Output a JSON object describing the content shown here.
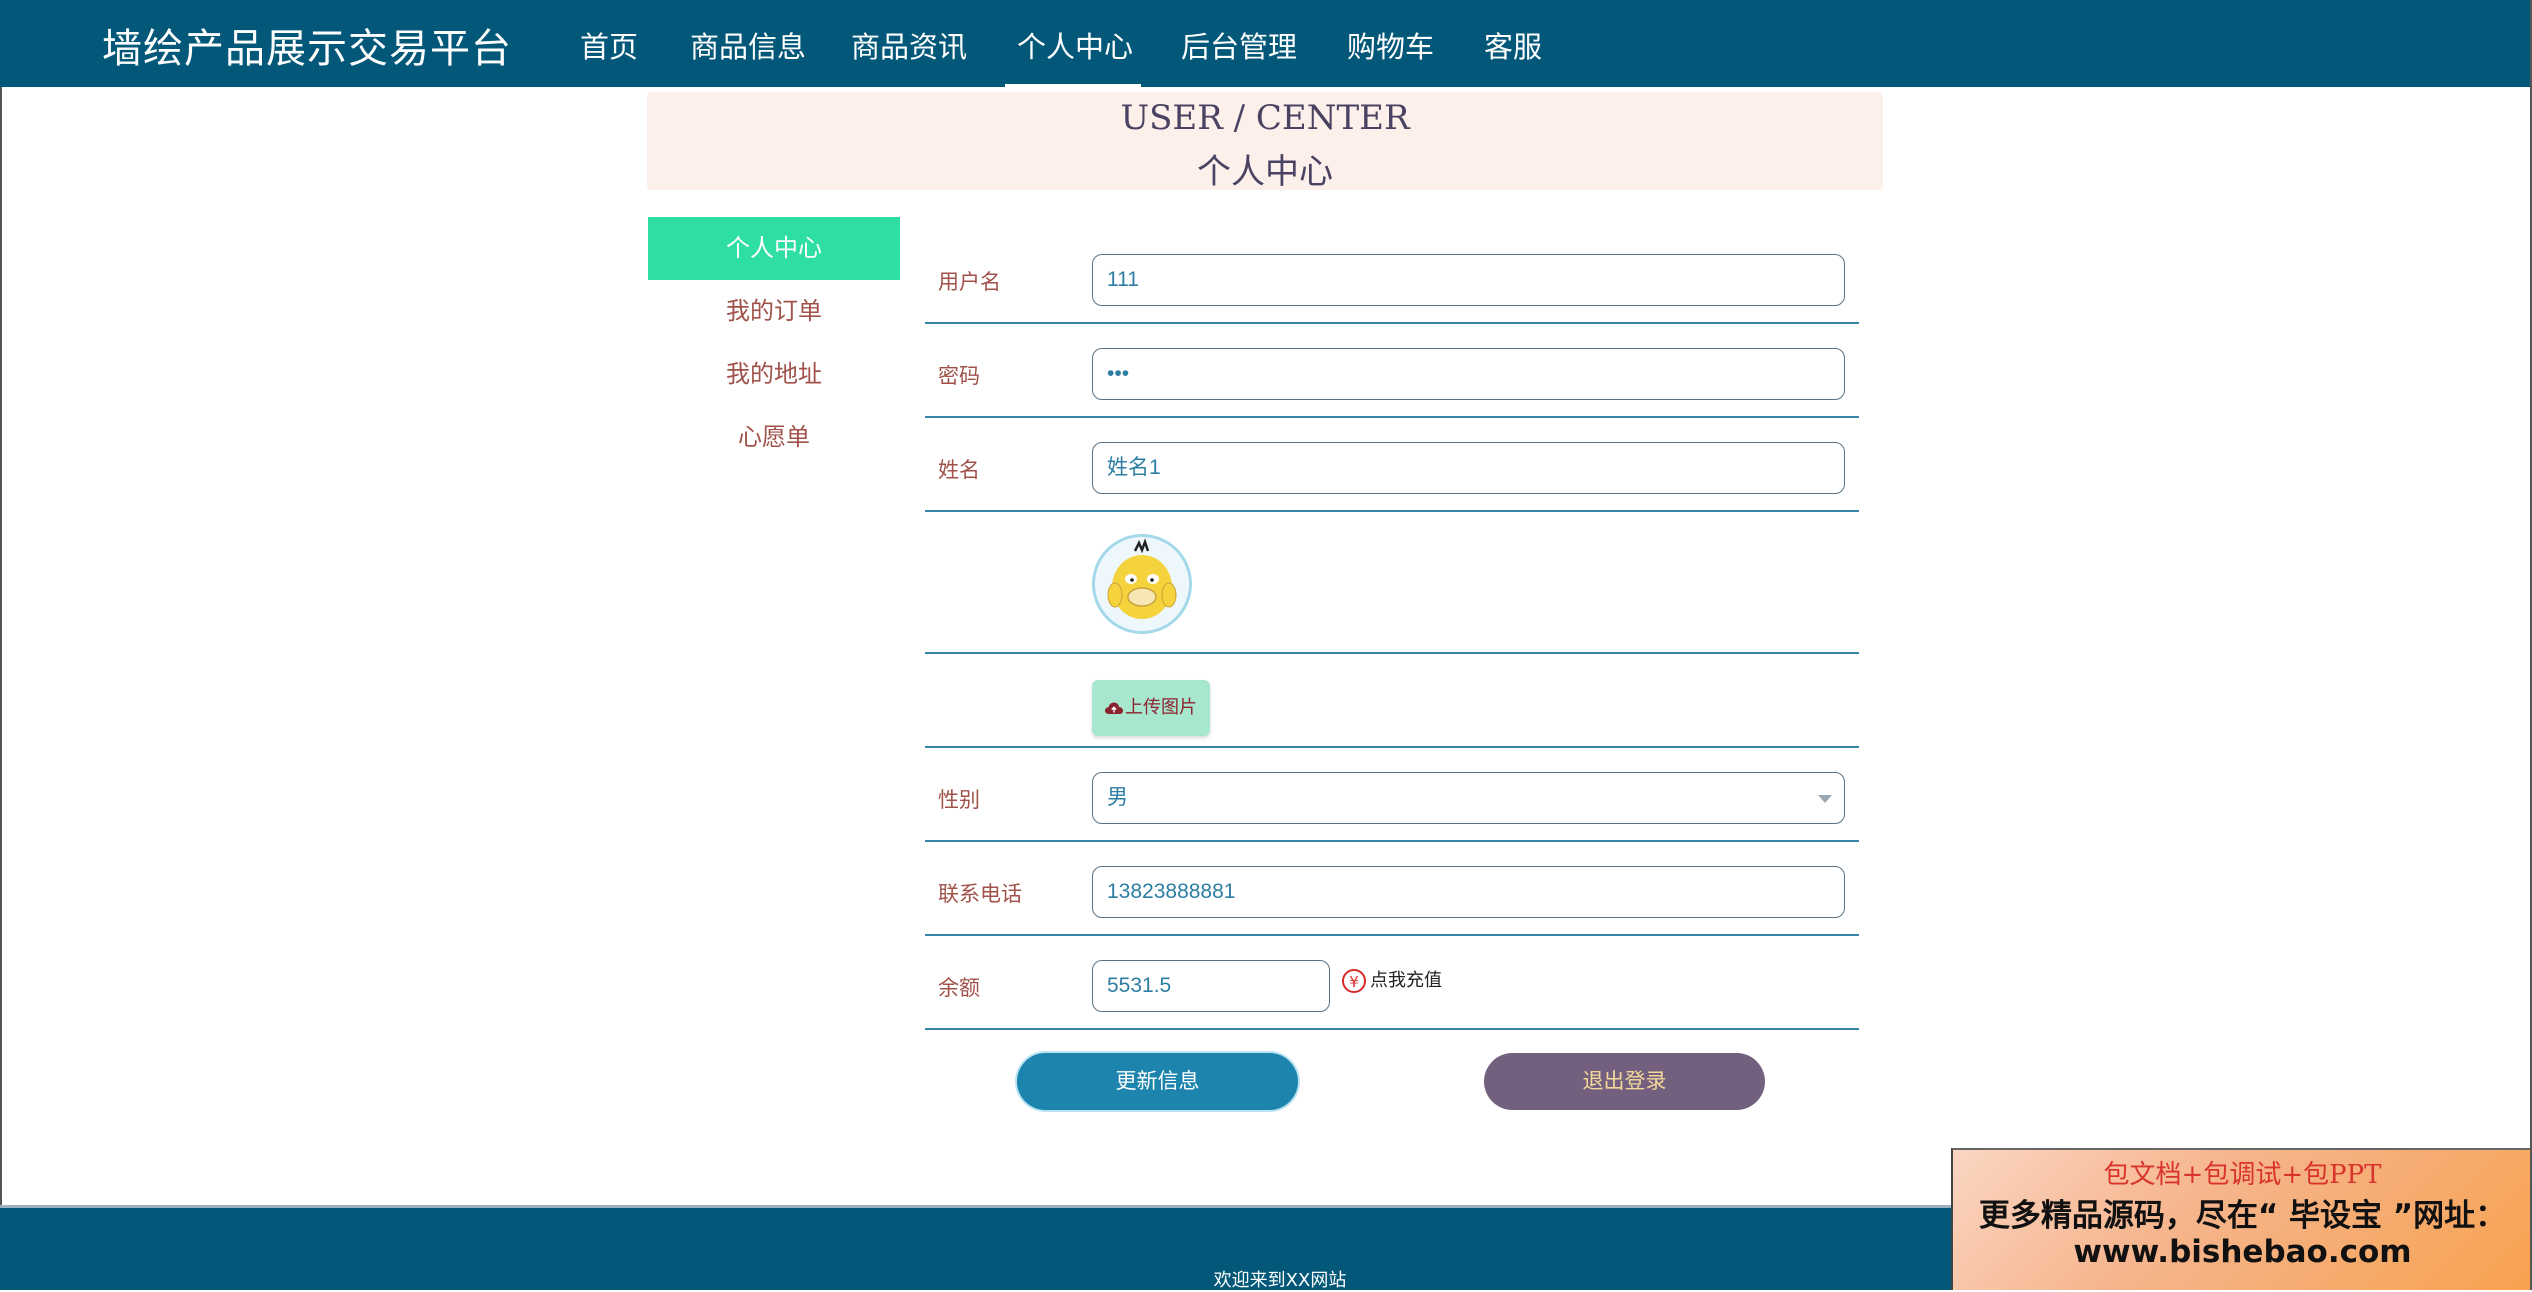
{
  "header": {
    "brand": "墙绘产品展示交易平台",
    "nav": [
      "首页",
      "商品信息",
      "商品资讯",
      "个人中心",
      "后台管理",
      "购物车",
      "客服"
    ],
    "active_nav": "个人中心"
  },
  "banner": {
    "en": "USER / CENTER",
    "cn": "个人中心"
  },
  "sidebar": {
    "items": [
      {
        "label": "个人中心",
        "active": true
      },
      {
        "label": "我的订单",
        "active": false
      },
      {
        "label": "我的地址",
        "active": false
      },
      {
        "label": "心愿单",
        "active": false
      }
    ]
  },
  "form": {
    "username": {
      "label": "用户名",
      "value": "111"
    },
    "password": {
      "label": "密码",
      "value": "•••"
    },
    "name": {
      "label": "姓名",
      "value": "姓名1"
    },
    "upload": {
      "label": "上传图片",
      "icon": "cloud-upload-icon"
    },
    "gender": {
      "label": "性别",
      "value": "男"
    },
    "phone": {
      "label": "联系电话",
      "value": "13823888881"
    },
    "balance": {
      "label": "余额",
      "value": "5531.5",
      "recharge_label": "点我充值",
      "recharge_icon": "¥"
    }
  },
  "actions": {
    "update": "更新信息",
    "logout": "退出登录"
  },
  "footer": {
    "text": "欢迎来到XX网站"
  },
  "promo": {
    "line1": "包文档+包调试+包PPT",
    "line2": "更多精品源码，尽在“ 毕设宝 ”网址：",
    "line3": "www.bishebao.com"
  },
  "colors": {
    "header_bg": "#03587a",
    "active_sidebar": "#2fdfa1",
    "banner_bg": "#fdefe9",
    "update_button": "#1d84ad",
    "logout_button": "#73607f"
  }
}
